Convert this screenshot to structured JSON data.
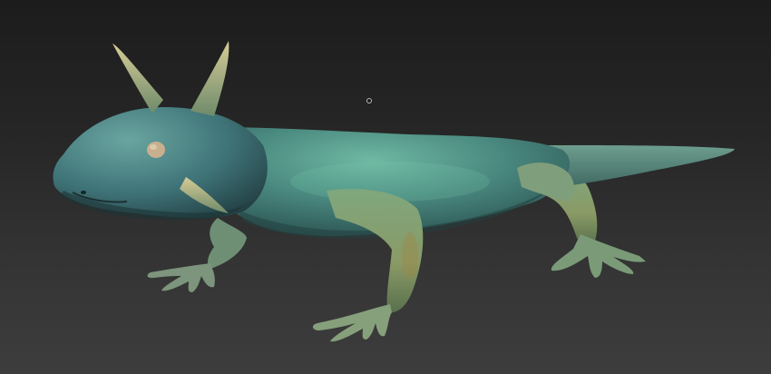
{
  "viewport": {
    "background_top": "#1c1c1c",
    "background_bottom": "#3d3d3d"
  },
  "model": {
    "subject": "axolotl-sculpt",
    "skin_base": "#4a8a80",
    "skin_highlight": "#6fb8a2",
    "skin_shadow": "#274a4a",
    "limb_tint": "#8a9a66",
    "horn_color": "#c9c08a",
    "eye_color": "#c8b08e"
  },
  "cursor": {
    "icon": "cursor-dot-icon"
  }
}
